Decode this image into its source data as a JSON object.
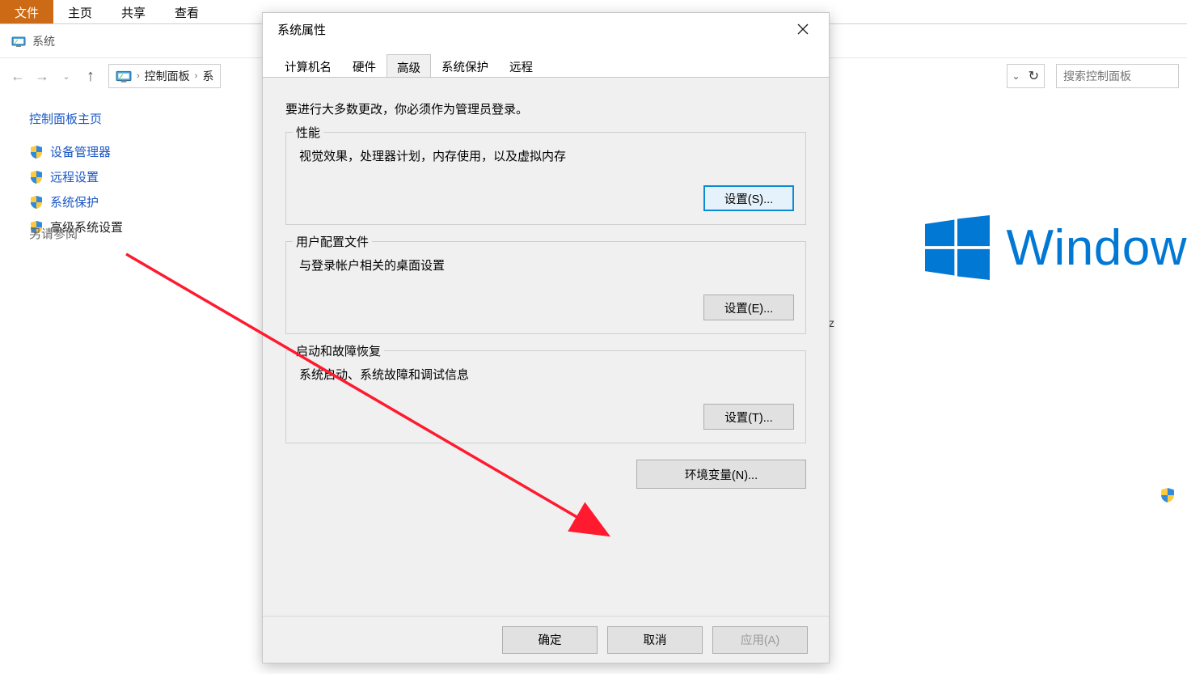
{
  "ribbon": {
    "tabs": [
      "文件",
      "主页",
      "共享",
      "查看"
    ],
    "active_index": 0
  },
  "titlebar": {
    "title": "系统"
  },
  "breadcrumb": {
    "parts": [
      "控制面板",
      "系"
    ],
    "dropdown_hint": "v",
    "refresh_hint": "↻"
  },
  "search": {
    "placeholder": "搜索控制面板"
  },
  "sidebar": {
    "home": "控制面板主页",
    "items": [
      "设备管理器",
      "远程设置",
      "系统保护",
      "高级系统设置"
    ],
    "see_also": "另请参阅"
  },
  "right": {
    "windows_word": "Window",
    "stray_z": "z"
  },
  "dialog": {
    "title": "系统属性",
    "tabs": [
      "计算机名",
      "硬件",
      "高级",
      "系统保护",
      "远程"
    ],
    "active_tab_index": 2,
    "note": "要进行大多数更改，你必须作为管理员登录。",
    "groups": {
      "perf": {
        "legend": "性能",
        "desc": "视觉效果，处理器计划，内存使用，以及虚拟内存",
        "button": "设置(S)..."
      },
      "profile": {
        "legend": "用户配置文件",
        "desc": "与登录帐户相关的桌面设置",
        "button": "设置(E)..."
      },
      "startup": {
        "legend": "启动和故障恢复",
        "desc": "系统启动、系统故障和调试信息",
        "button": "设置(T)..."
      }
    },
    "env_button": "环境变量(N)...",
    "footer": {
      "ok": "确定",
      "cancel": "取消",
      "apply": "应用(A)"
    }
  }
}
